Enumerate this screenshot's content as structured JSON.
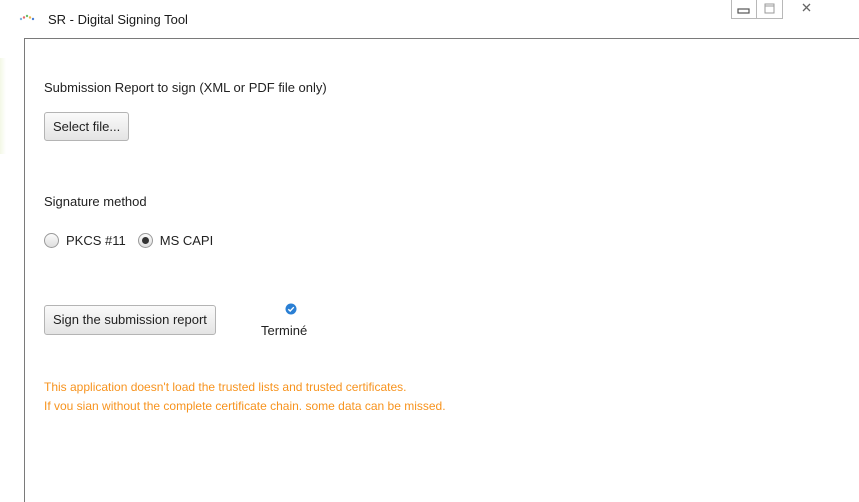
{
  "window": {
    "title": "SR - Digital Signing Tool",
    "controls": [
      "minimize-icon",
      "maximize-icon",
      "close-icon"
    ]
  },
  "file_section": {
    "label": "Submission Report to sign (XML or PDF file only)",
    "select_button": "Select file..."
  },
  "signature_section": {
    "label": "Signature method",
    "options": [
      {
        "label": "PKCS #11",
        "selected": false
      },
      {
        "label": "MS CAPI",
        "selected": true
      }
    ]
  },
  "sign_section": {
    "sign_button": "Sign the submission report",
    "status": "Terminé",
    "status_icon": "check-circle-icon"
  },
  "warning": {
    "line1": "This application doesn't load the trusted lists and trusted certificates.",
    "line2": "If vou sian without the complete certificate chain. some data can be missed.",
    "color": "#f7931e"
  },
  "colors": {
    "accent_blue": "#2a7fd4",
    "warning_orange": "#f7931e"
  }
}
